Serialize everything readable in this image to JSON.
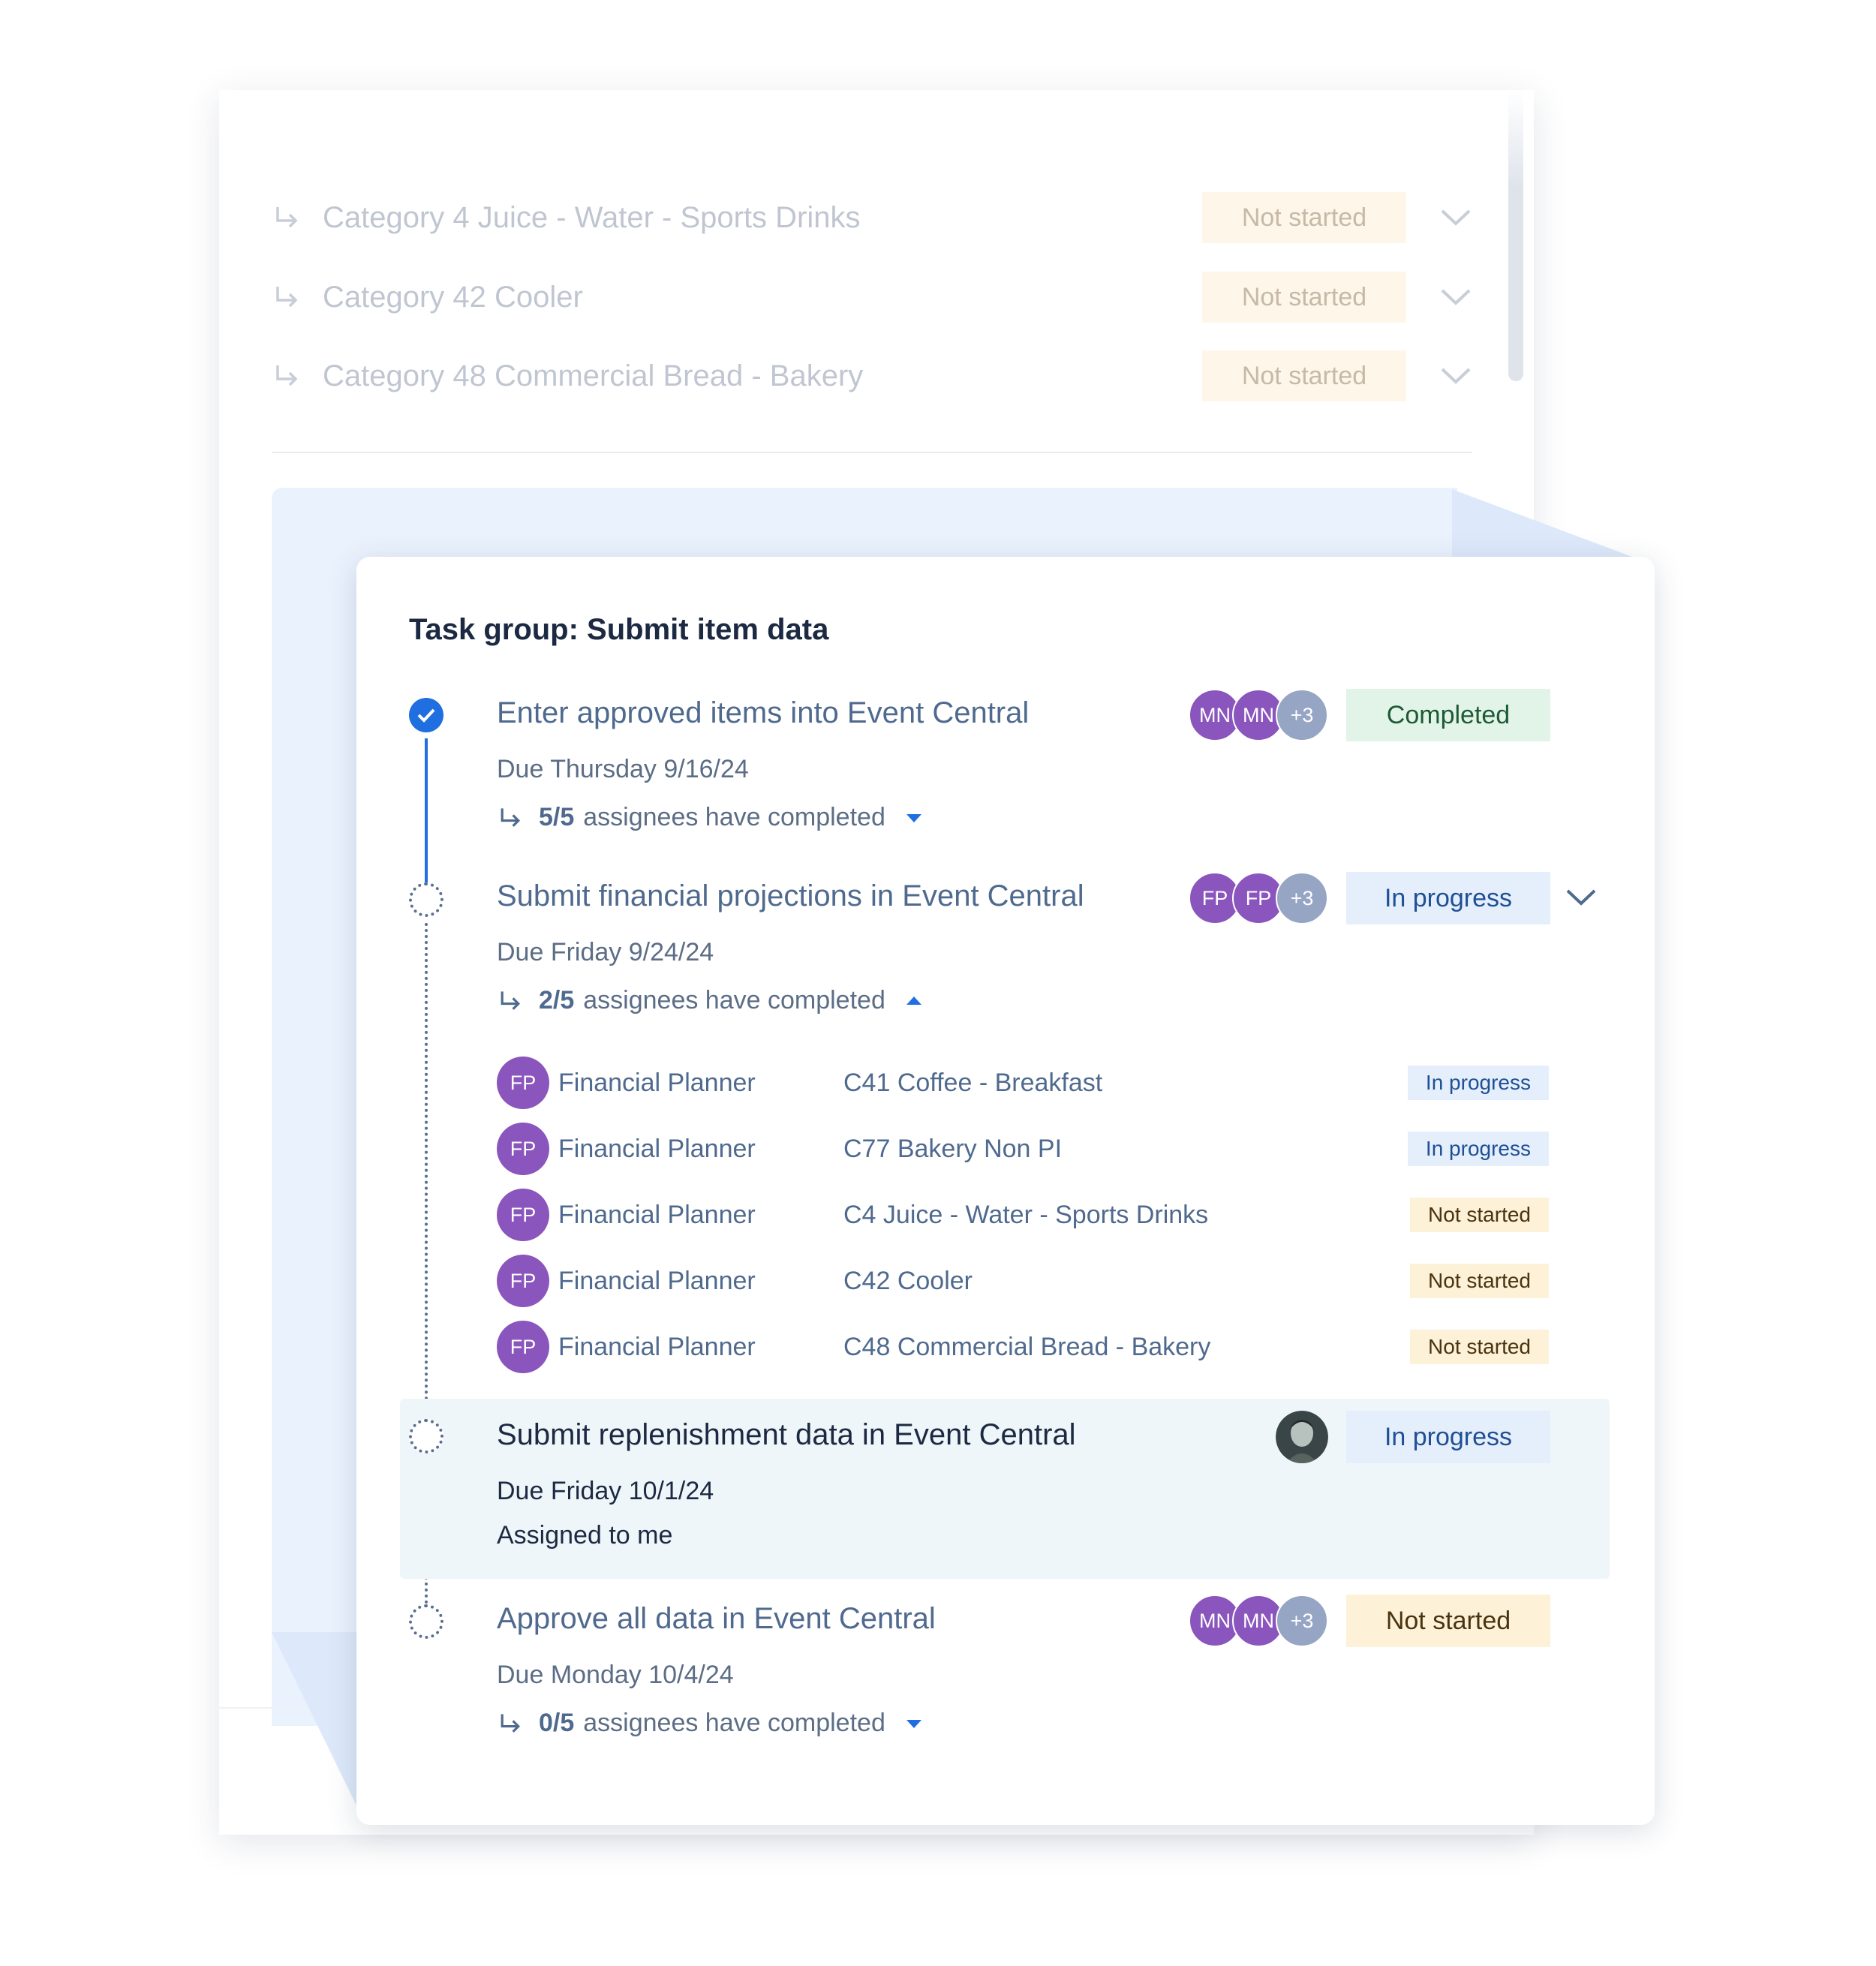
{
  "background": {
    "categories": [
      {
        "label": "Category 4 Juice - Water - Sports Drinks",
        "status": "Not started"
      },
      {
        "label": "Category 42 Cooler",
        "status": "Not started"
      },
      {
        "label": "Category 48 Commercial Bread - Bakery",
        "status": "Not started"
      }
    ]
  },
  "task_group": {
    "title": "Task group: Submit item data",
    "tasks": [
      {
        "title": "Enter approved items into Event Central",
        "due": "Due Thursday 9/16/24",
        "assignee_count": "5/5",
        "assignee_text": "assignees have completed",
        "avatars": [
          "MN",
          "MN",
          "+3"
        ],
        "status": "Completed"
      },
      {
        "title": "Submit financial projections in Event Central",
        "due": "Due Friday 9/24/24",
        "assignee_count": "2/5",
        "assignee_text": "assignees have completed",
        "avatars": [
          "FP",
          "FP",
          "+3"
        ],
        "status": "In progress",
        "assignees": [
          {
            "initials": "FP",
            "role": "Financial Planner",
            "category": "C41 Coffee - Breakfast",
            "status": "In progress"
          },
          {
            "initials": "FP",
            "role": "Financial Planner",
            "category": "C77 Bakery Non PI",
            "status": "In progress"
          },
          {
            "initials": "FP",
            "role": "Financial Planner",
            "category": "C4 Juice - Water - Sports Drinks",
            "status": "Not started"
          },
          {
            "initials": "FP",
            "role": "Financial Planner",
            "category": "C42 Cooler",
            "status": "Not started"
          },
          {
            "initials": "FP",
            "role": "Financial Planner",
            "category": "C48 Commercial Bread - Bakery",
            "status": "Not started"
          }
        ]
      },
      {
        "title": "Submit replenishment data in Event Central",
        "due": "Due Friday 10/1/24",
        "assigned": "Assigned to me",
        "status": "In progress"
      },
      {
        "title": "Approve all data in Event Central",
        "due": "Due Monday 10/4/24",
        "assignee_count": "0/5",
        "assignee_text": "assignees have completed",
        "avatars": [
          "MN",
          "MN",
          "+3"
        ],
        "status": "Not started"
      }
    ]
  },
  "colors": {
    "accent": "#1f6fe0",
    "avatar_purple": "#8a55bd",
    "completed_bg": "#e2f4e8",
    "in_progress_bg": "#e5effc",
    "not_started_bg": "#fdf1d8"
  }
}
